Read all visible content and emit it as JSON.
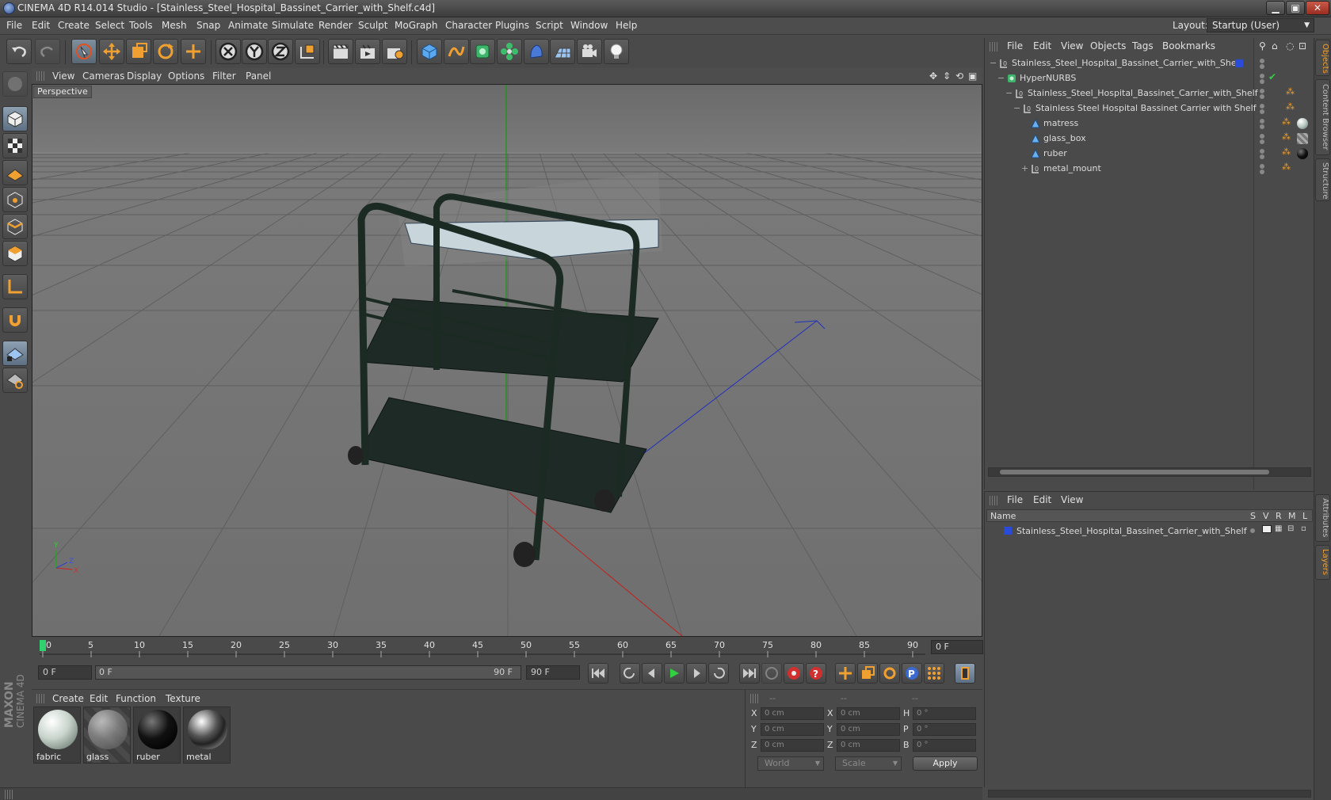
{
  "window": {
    "title": "CINEMA 4D R14.014 Studio - [Stainless_Steel_Hospital_Bassinet_Carrier_with_Shelf.c4d]",
    "minimize": "▁",
    "maximize": "▣",
    "close": "✕"
  },
  "menubar": {
    "items": [
      "File",
      "Edit",
      "Create",
      "Select",
      "Tools",
      "Mesh",
      "Snap",
      "Animate",
      "Simulate",
      "Render",
      "Sculpt",
      "MoGraph",
      "Character",
      "Plugins",
      "Script",
      "Window",
      "Help"
    ],
    "layout_label": "Layout:",
    "layout_value": "Startup (User)"
  },
  "viewport": {
    "menu": [
      "View",
      "Cameras",
      "Display",
      "Options",
      "Filter",
      "Panel"
    ],
    "camera_label": "Perspective",
    "axis_labels": {
      "y": "Y",
      "x": "X",
      "z": "Z"
    }
  },
  "timeline": {
    "ticks": [
      "0",
      "5",
      "10",
      "15",
      "20",
      "25",
      "30",
      "35",
      "40",
      "45",
      "50",
      "55",
      "60",
      "65",
      "70",
      "75",
      "80",
      "85",
      "90"
    ],
    "current_frame": "0 F",
    "start_field": "0 F",
    "range_start": "0 F",
    "range_end": "90 F",
    "end_field": "90 F"
  },
  "materials": {
    "menu": [
      "Create",
      "Edit",
      "Function",
      "Texture"
    ],
    "items": [
      {
        "name": "fabric"
      },
      {
        "name": "glass"
      },
      {
        "name": "ruber"
      },
      {
        "name": "metal"
      }
    ]
  },
  "coordinates": {
    "headers": [
      "--",
      "--",
      "--"
    ],
    "rows": [
      {
        "a": "X",
        "av": "0 cm",
        "b": "X",
        "bv": "0 cm",
        "c": "H",
        "cv": "0 °"
      },
      {
        "a": "Y",
        "av": "0 cm",
        "b": "Y",
        "bv": "0 cm",
        "c": "P",
        "cv": "0 °"
      },
      {
        "a": "Z",
        "av": "0 cm",
        "b": "Z",
        "bv": "0 cm",
        "c": "B",
        "cv": "0 °"
      }
    ],
    "space": "World",
    "mode": "Scale",
    "apply": "Apply"
  },
  "object_manager": {
    "menu": [
      "File",
      "Edit",
      "View",
      "Objects",
      "Tags",
      "Bookmarks"
    ],
    "rows": [
      {
        "name": "Stainless_Steel_Hospital_Bassinet_Carrier_with_Shelf",
        "type": "null",
        "expand": "−"
      },
      {
        "name": "HyperNURBS",
        "type": "nurbs",
        "expand": "−"
      },
      {
        "name": "Stainless_Steel_Hospital_Bassinet_Carrier_with_Shelf",
        "type": "null",
        "expand": "−"
      },
      {
        "name": "Stainless Steel Hospital Bassinet Carrier with Shelf",
        "type": "null",
        "expand": "−"
      },
      {
        "name": "matress",
        "type": "poly",
        "expand": ""
      },
      {
        "name": "glass_box",
        "type": "poly",
        "expand": ""
      },
      {
        "name": "ruber",
        "type": "poly",
        "expand": ""
      },
      {
        "name": "metal_mount",
        "type": "null",
        "expand": "+"
      }
    ]
  },
  "layer_manager": {
    "menu": [
      "File",
      "Edit",
      "View"
    ],
    "columns": [
      "Name",
      "S",
      "V",
      "R",
      "M",
      "L"
    ],
    "layers": [
      {
        "name": "Stainless_Steel_Hospital_Bassinet_Carrier_with_Shelf",
        "color": "#2a4bd8"
      }
    ]
  },
  "right_tabs": [
    "Objects",
    "Content Browser",
    "Structure",
    "Attributes",
    "Layers"
  ],
  "colors": {
    "accent": "#f0a030",
    "layer_blue": "#2a4bd8",
    "grid_green": "#00a000"
  }
}
